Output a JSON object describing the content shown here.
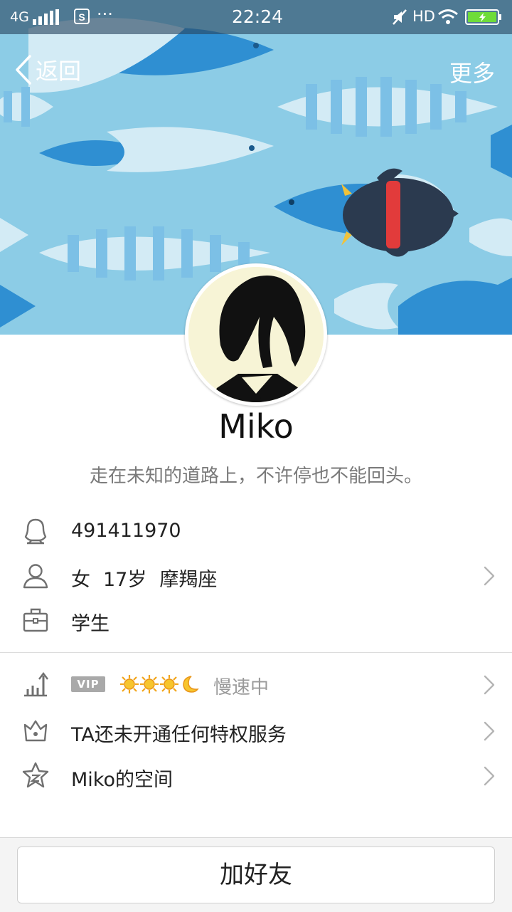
{
  "status_bar": {
    "network": "4G",
    "time": "22:24",
    "hd": "HD"
  },
  "nav": {
    "back_label": "返回",
    "more_label": "更多"
  },
  "profile": {
    "name": "Miko",
    "signature": "走在未知的道路上，不许停也不能回头。",
    "qq_number": "491411970",
    "gender": "女",
    "age": "17岁",
    "zodiac": "摩羯座",
    "occupation": "学生"
  },
  "level": {
    "vip_badge": "VIP",
    "speed_text": "慢速中",
    "suns": 3,
    "moons": 1
  },
  "privilege": {
    "text": "TA还未开通任何特权服务"
  },
  "space": {
    "text": "Miko的空间"
  },
  "actions": {
    "add_friend_label": "加好友"
  },
  "colors": {
    "banner_bg": "#8ccce6",
    "fish_dark": "#2f8fd2",
    "fish_light": "#d3ebf5",
    "penguin": "#2b3a4f",
    "scarf": "#e23b3b"
  }
}
